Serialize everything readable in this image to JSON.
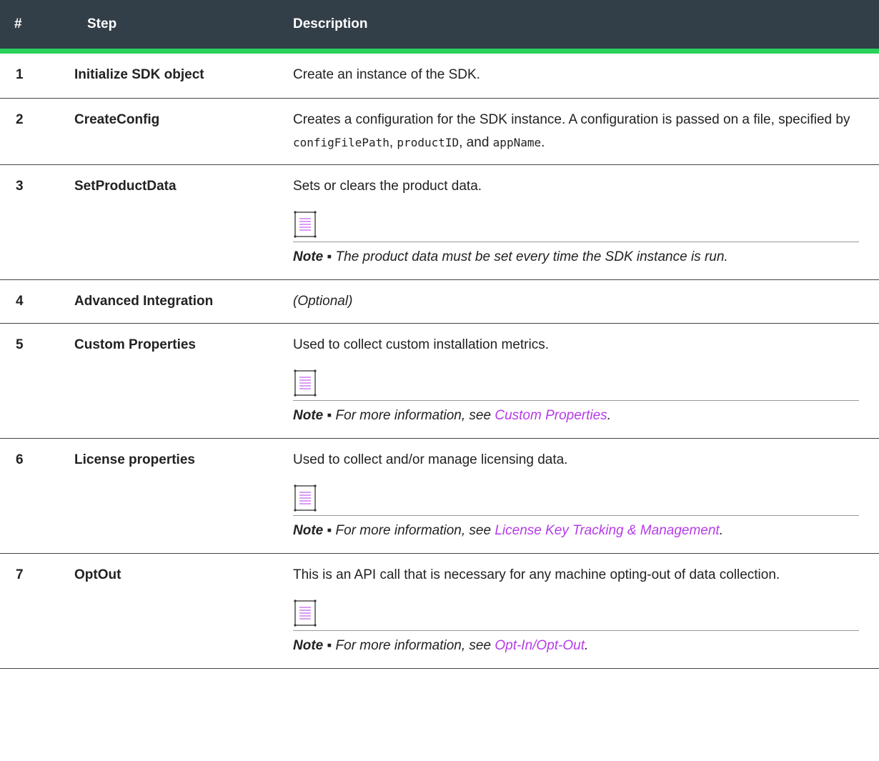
{
  "header": {
    "num": "#",
    "step": "Step",
    "description": "Description"
  },
  "rows": [
    {
      "num": "1",
      "step": "Initialize SDK object",
      "desc": "Create an instance of the SDK."
    },
    {
      "num": "2",
      "step": "CreateConfig",
      "desc_parts": [
        "Creates a configuration for the SDK instance. A configuration is passed on a file, specified by ",
        "configFilePath",
        ", ",
        "productID",
        ", and ",
        "appName",
        "."
      ]
    },
    {
      "num": "3",
      "step": "SetProductData",
      "desc": "Sets or clears the product data.",
      "note": {
        "label": "Note",
        "sep": " ▪ ",
        "text": "The product data must be set every time the SDK instance is run."
      }
    },
    {
      "num": "4",
      "step": "Advanced Integration",
      "desc": "(Optional)"
    },
    {
      "num": "5",
      "step": "Custom Properties",
      "desc": "Used to collect custom installation metrics.",
      "note": {
        "label": "Note",
        "sep": " ▪ ",
        "text": "For more information, see ",
        "link": "Custom Properties",
        "after": "."
      }
    },
    {
      "num": "6",
      "step": "License properties",
      "desc": "Used to collect and/or manage licensing data.",
      "note": {
        "label": "Note",
        "sep": " ▪ ",
        "text": "For more information, see ",
        "link": "License Key Tracking & Management",
        "after": "."
      }
    },
    {
      "num": "7",
      "step": "OptOut",
      "desc": "This is an API call that is necessary for any machine opting-out of data collection.",
      "note": {
        "label": "Note",
        "sep": " ▪ ",
        "text": "For more information, see ",
        "link": "Opt-In/Opt-Out",
        "after": "."
      }
    }
  ],
  "icons": {
    "note": "note-icon"
  },
  "colors": {
    "header_bg": "#323e48",
    "header_rule": "#29d05b",
    "link": "#b73be8"
  }
}
